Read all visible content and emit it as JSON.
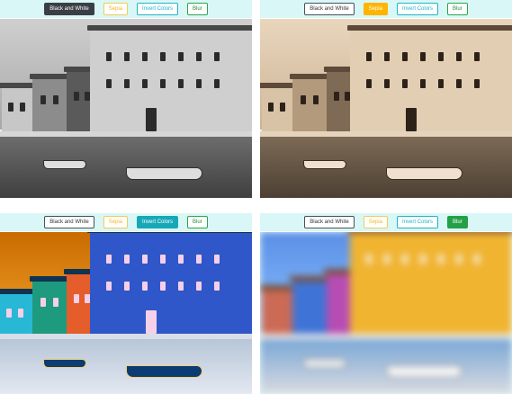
{
  "controls": {
    "bw_label": "Black and White",
    "sepia_label": "Sepia",
    "invert_label": "Invert Colors",
    "blur_label": "Blur"
  },
  "panels": [
    {
      "active": "bw",
      "active_color": "#3a3f46"
    },
    {
      "active": "sepia",
      "active_color": "#ffb400"
    },
    {
      "active": "invert",
      "active_color": "#17a8b8"
    },
    {
      "active": "blur",
      "active_color": "#24a146"
    }
  ]
}
